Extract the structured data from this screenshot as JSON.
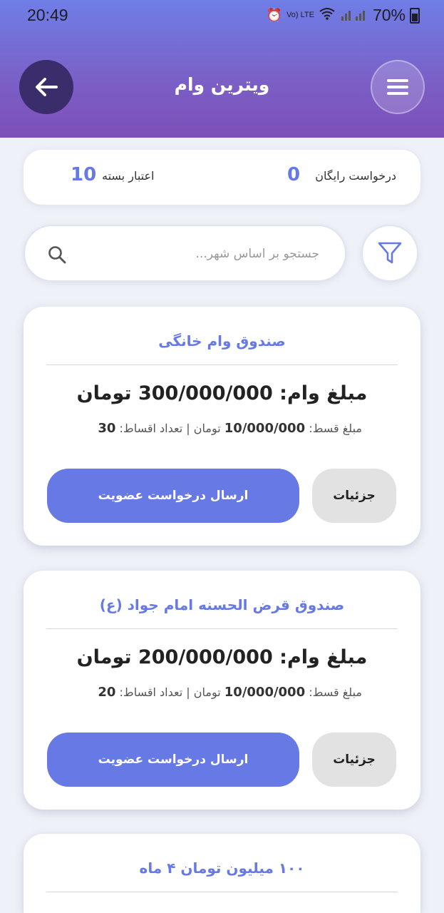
{
  "status_bar": {
    "time": "20:49",
    "network": "Vo) LTE",
    "battery_percent": "70%"
  },
  "header": {
    "title": "ویترین وام",
    "menu_icon": "hamburger-icon",
    "back_icon": "arrow-left-icon"
  },
  "summary": {
    "free_requests_label": "درخواست رایگان",
    "free_requests_value": "0",
    "package_credit_label": "اعتبار بسته",
    "package_credit_value": "10"
  },
  "search": {
    "placeholder": "جستجو بر اساس شهر...",
    "value": ""
  },
  "colors": {
    "accent": "#6679e4",
    "header_top": "#6f7ee6",
    "header_bottom": "#7c4fb8",
    "back_button": "#3b2c6b",
    "secondary_button": "#e2e2e2"
  },
  "cards": [
    {
      "name": "صندوق وام خانگی",
      "amount_label": "مبلغ وام:",
      "amount_value": "300/000/000",
      "currency": "تومان",
      "installment_label": "مبلغ قسط:",
      "installment_value": "10/000/000",
      "installment_currency": "تومان",
      "separator": "|",
      "count_label": "تعداد اقساط:",
      "count_value": "30",
      "details_label": "جزئیات",
      "join_label": "ارسال درخواست عضویت"
    },
    {
      "name": "صندوق قرض الحسنه امام جواد (ع)",
      "amount_label": "مبلغ وام:",
      "amount_value": "200/000/000",
      "currency": "تومان",
      "installment_label": "مبلغ قسط:",
      "installment_value": "10/000/000",
      "installment_currency": "تومان",
      "separator": "|",
      "count_label": "تعداد اقساط:",
      "count_value": "20",
      "details_label": "جزئیات",
      "join_label": "ارسال درخواست عضویت"
    },
    {
      "name": "۱۰۰ میلیون تومان ۴ ماه"
    }
  ]
}
